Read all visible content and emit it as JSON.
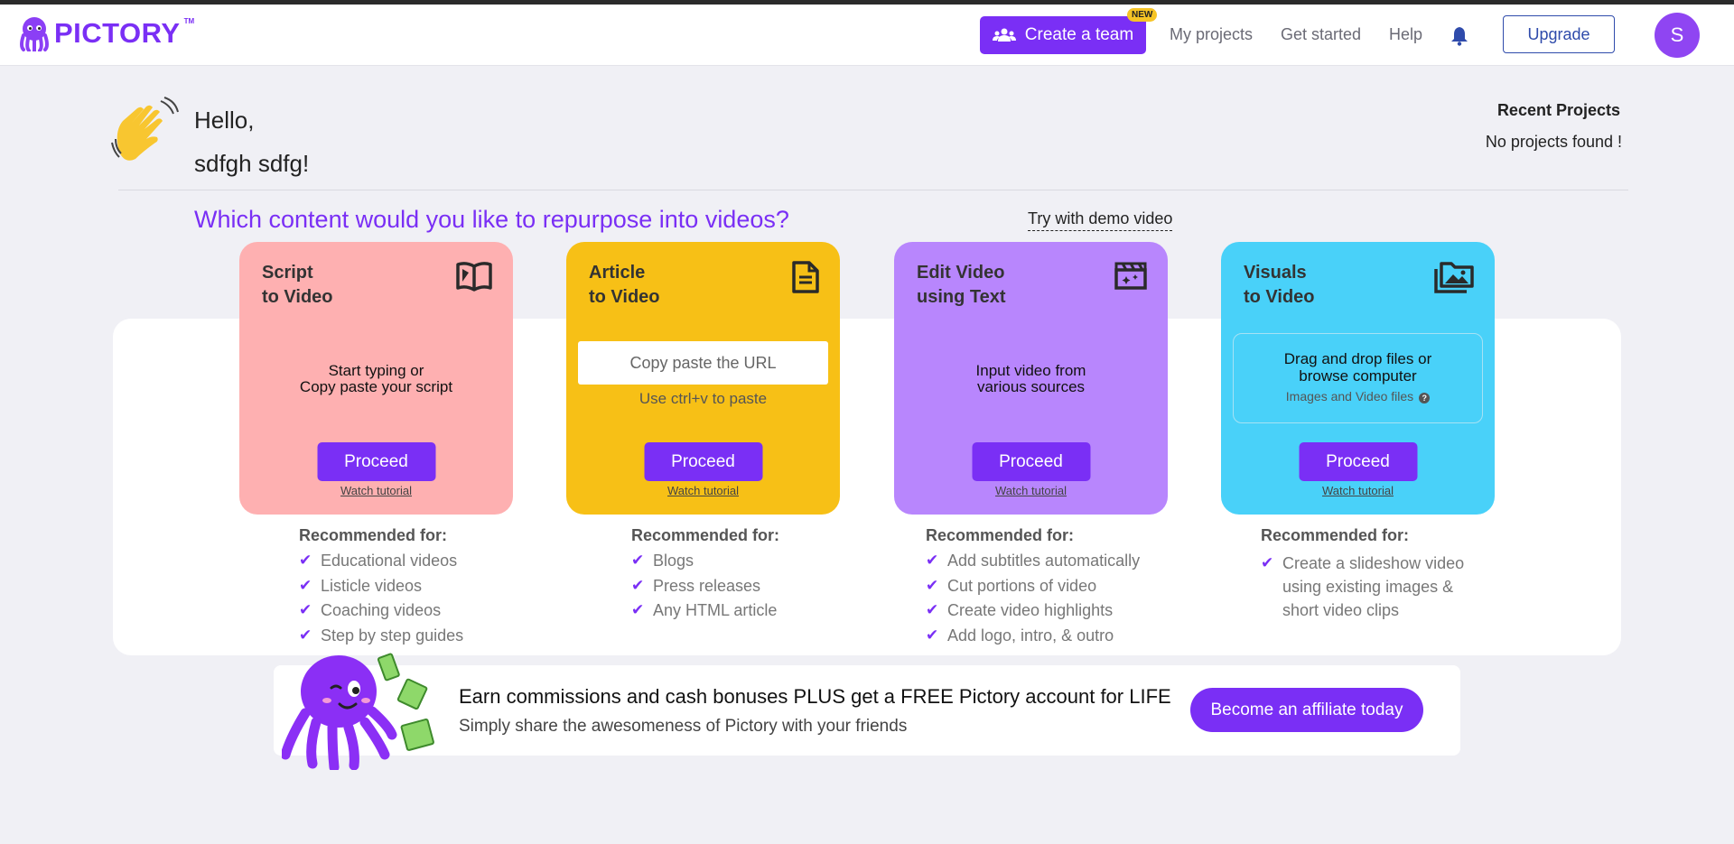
{
  "header": {
    "logo_text": "PICTORY",
    "logo_tm": "TM",
    "create_team_label": "Create a team",
    "new_badge": "NEW",
    "nav": [
      "My projects",
      "Get started",
      "Help"
    ],
    "upgrade_label": "Upgrade",
    "avatar_initial": "S"
  },
  "greeting": {
    "hello": "Hello,",
    "name": "sdfgh sdfg!"
  },
  "recent": {
    "title": "Recent Projects",
    "empty": "No projects found !"
  },
  "question": "Which content would you like to repurpose into videos?",
  "demo_link": "Try with demo video",
  "cards": [
    {
      "title": "Script\nto Video",
      "icon": "open-book-icon",
      "color": "#feb0b1",
      "body": "Start typing or\nCopy paste your script",
      "proceed": "Proceed",
      "tutorial": "Watch tutorial",
      "rec_title": "Recommended for:",
      "rec": [
        "Educational videos",
        "Listicle videos",
        "Coaching videos",
        "Step by step guides"
      ]
    },
    {
      "title": "Article\nto Video",
      "icon": "document-icon",
      "color": "#f7c016",
      "url_placeholder": "Copy paste the URL",
      "url_hint": "Use ctrl+v to paste",
      "proceed": "Proceed",
      "tutorial": "Watch tutorial",
      "rec_title": "Recommended for:",
      "rec": [
        "Blogs",
        "Press releases",
        "Any HTML article"
      ]
    },
    {
      "title": "Edit Video\nusing Text",
      "icon": "clapperboard-icon",
      "color": "#b886fd",
      "body": "Input video from\nvarious sources",
      "proceed": "Proceed",
      "tutorial": "Watch tutorial",
      "rec_title": "Recommended for:",
      "rec": [
        "Add subtitles automatically",
        "Cut portions of video",
        "Create video highlights",
        "Add logo, intro, & outro"
      ]
    },
    {
      "title": "Visuals\nto Video",
      "icon": "images-folder-icon",
      "color": "#49d1f9",
      "dropzone_main": "Drag and drop files or\nbrowse computer",
      "dropzone_sub": "Images and Video files",
      "proceed": "Proceed",
      "tutorial": "Watch tutorial",
      "rec_title": "Recommended for:",
      "rec": [
        "Create a slideshow video\n using existing images &\n short video clips"
      ]
    }
  ],
  "affiliate": {
    "title": "Earn commissions and cash bonuses PLUS get a FREE Pictory account for LIFE",
    "subtitle": "Simply share the awesomeness of Pictory with your friends",
    "button": "Become an affiliate today"
  },
  "colors": {
    "brand": "#7a2ff5",
    "upgrade": "#2f4bab",
    "background": "#f0f0f5"
  }
}
